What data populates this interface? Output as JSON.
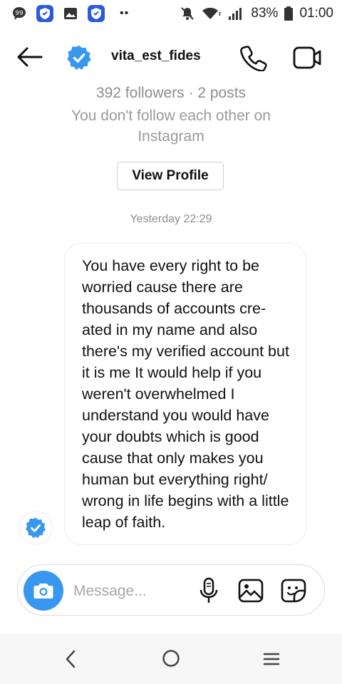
{
  "status_bar": {
    "battery_percent": "83%",
    "time": "01:00",
    "left_icons": [
      "chat-bubble-icon",
      "shield-app-icon",
      "image-icon",
      "shield-app-icon"
    ],
    "right_icons": [
      "mute-icon",
      "wifi-icon",
      "signal-icon",
      "battery-icon"
    ]
  },
  "header": {
    "username": "vita_est_fides",
    "back_icon": "arrow-left-icon",
    "call_icon": "phone-icon",
    "video_icon": "video-camera-icon",
    "verified_color": "#3897f0"
  },
  "profile_summary": {
    "followers_line": "392 followers · 2 posts",
    "mutual_line": "You don't follow each other on Instagram",
    "view_profile_label": "View Profile"
  },
  "conversation": {
    "timestamp": "Yesterday 22:29",
    "messages": [
      {
        "sender": "vita_est_fides",
        "text": "You have every right to be worried cause there are thousands of accounts cre-ated in my name and also there's my verified account but it is me It would help if you weren't overwhelmed I understand you would have your doubts which is good cause that only makes you human but everything right/ wrong in life begins with a little leap of faith."
      }
    ]
  },
  "composer": {
    "placeholder": "Message...",
    "value": "",
    "accent_color": "#3897f0",
    "icons": [
      "camera-icon",
      "microphone-icon",
      "gallery-icon",
      "sticker-icon"
    ]
  },
  "nav_bar": {
    "icons": [
      "back-chevron-icon",
      "home-circle-icon",
      "recents-icon"
    ]
  }
}
